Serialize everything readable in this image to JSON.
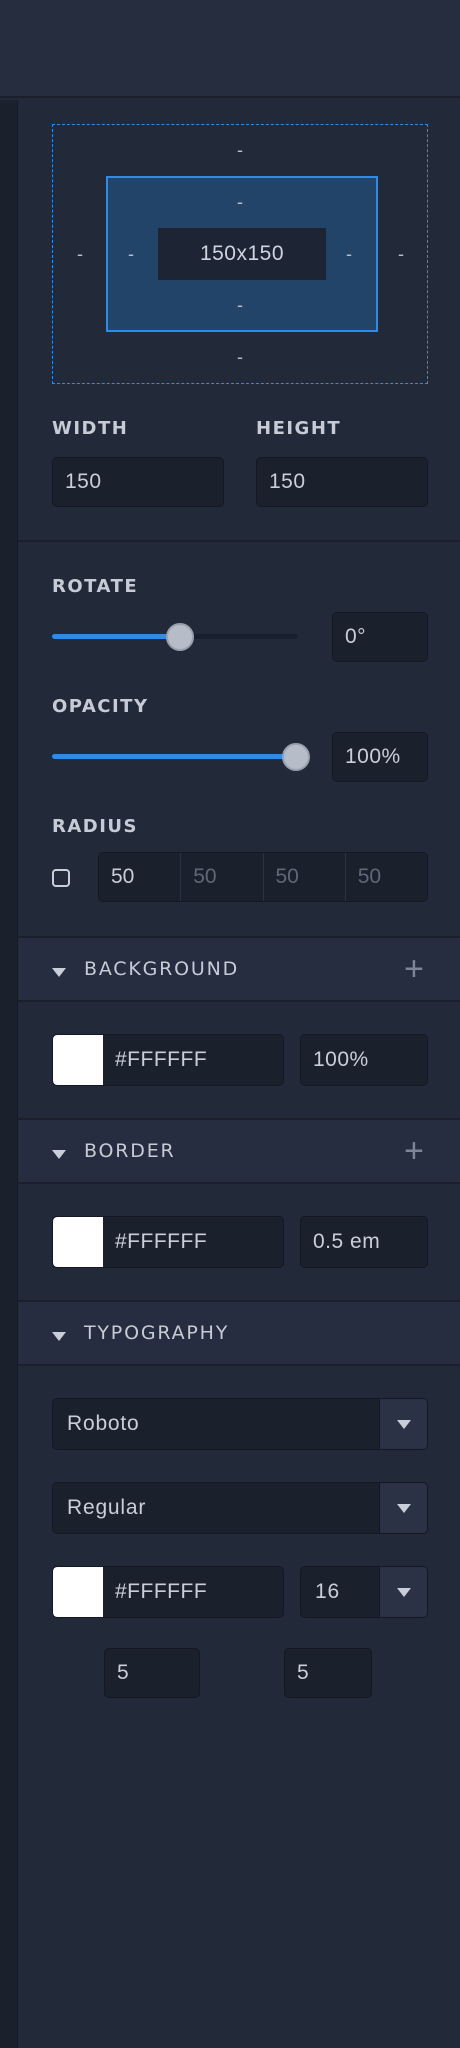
{
  "box_model": {
    "margin_top": "-",
    "margin_right": "-",
    "margin_bottom": "-",
    "margin_left": "-",
    "padding_top": "-",
    "padding_right": "-",
    "padding_bottom": "-",
    "padding_left": "-",
    "size": "150x150"
  },
  "dimensions": {
    "width_label": "WIDTH",
    "width_value": "150",
    "height_label": "HEIGHT",
    "height_value": "150"
  },
  "rotate": {
    "label": "ROTATE",
    "value": "0°",
    "level": 0.5
  },
  "opacity": {
    "label": "OPACITY",
    "value": "100%",
    "level": 1.0
  },
  "radius": {
    "label": "RADIUS",
    "values": [
      "50",
      "50",
      "50",
      "50"
    ]
  },
  "background": {
    "title": "BACKGROUND",
    "color": "#FFFFFF",
    "opacity": "100%",
    "swatch_color": "#FFFFFF"
  },
  "border": {
    "title": "BORDER",
    "color": "#FFFFFF",
    "width": "0.5 em",
    "swatch_color": "#FFFFFF"
  },
  "typography": {
    "title": "TYPOGRAPHY",
    "font_family": "Roboto",
    "font_weight": "Regular",
    "color": "#FFFFFF",
    "font_size": "16",
    "spacing_a": "5",
    "spacing_b": "5",
    "swatch_color": "#FFFFFF"
  },
  "icons": {
    "collapse": "caret-down-icon",
    "add": "plus-icon",
    "dropdown": "caret-down-icon"
  },
  "colors": {
    "accent": "#2f8be6",
    "panel_bg": "#222939",
    "input_bg": "#1b202d"
  }
}
